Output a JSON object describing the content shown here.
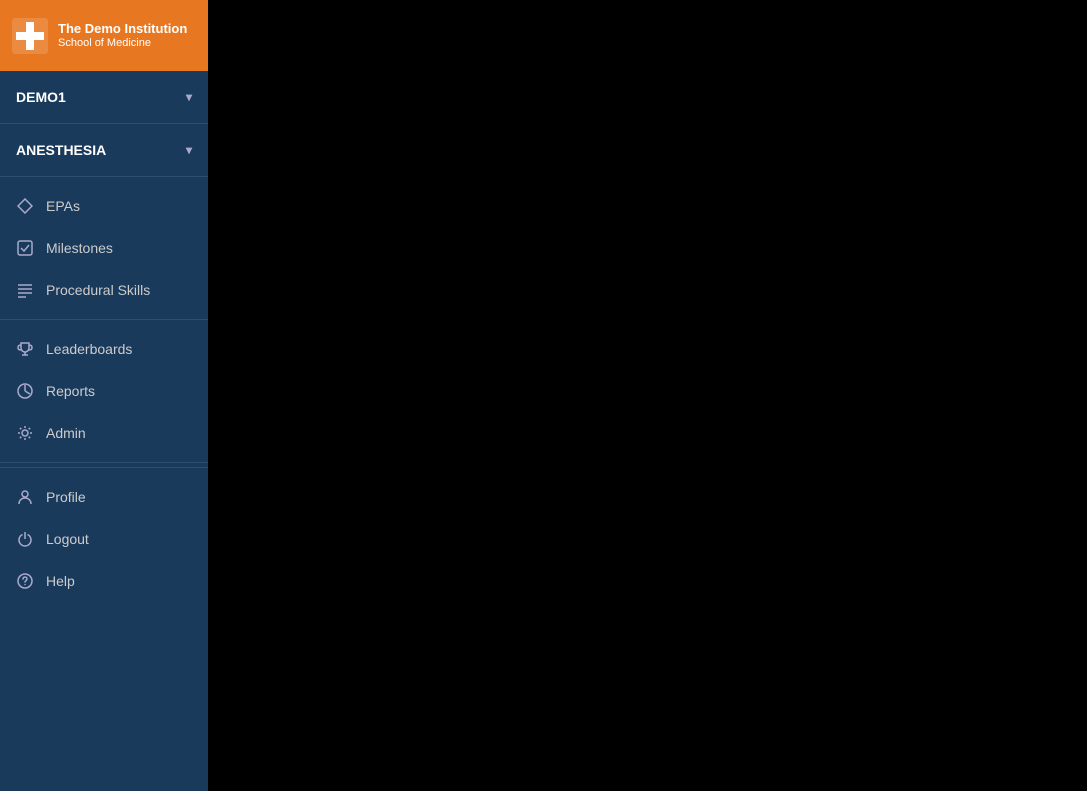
{
  "logo": {
    "title": "The Demo Institution",
    "subtitle": "School of Medicine"
  },
  "user_dropdown": {
    "label": "DEMO1",
    "arrow": "▾"
  },
  "role_dropdown": {
    "label": "ANESTHESIA",
    "arrow": "▾"
  },
  "nav": {
    "main_items": [
      {
        "id": "epas",
        "label": "EPAs",
        "icon": "diamond"
      },
      {
        "id": "milestones",
        "label": "Milestones",
        "icon": "check-square"
      },
      {
        "id": "procedural-skills",
        "label": "Procedural Skills",
        "icon": "list"
      }
    ],
    "secondary_items": [
      {
        "id": "leaderboards",
        "label": "Leaderboards",
        "icon": "trophy"
      },
      {
        "id": "reports",
        "label": "Reports",
        "icon": "chart"
      },
      {
        "id": "admin",
        "label": "Admin",
        "icon": "gear"
      }
    ],
    "bottom_items": [
      {
        "id": "profile",
        "label": "Profile",
        "icon": "user"
      },
      {
        "id": "logout",
        "label": "Logout",
        "icon": "power"
      },
      {
        "id": "help",
        "label": "Help",
        "icon": "question"
      }
    ]
  }
}
